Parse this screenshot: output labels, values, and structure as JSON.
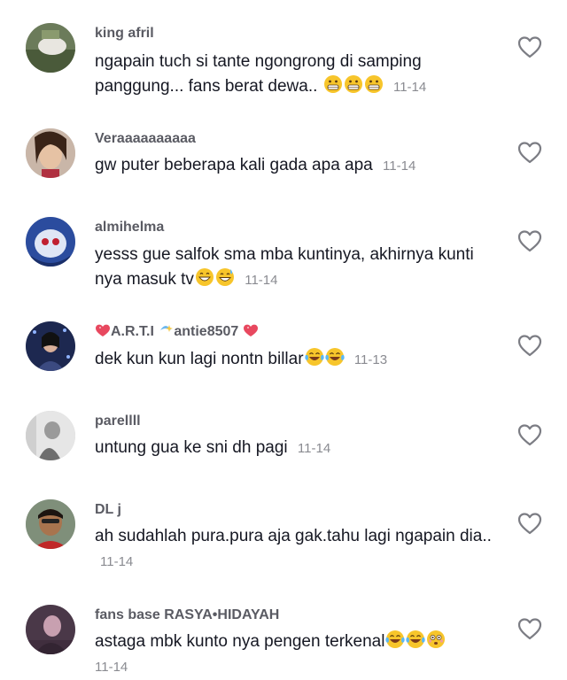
{
  "comments": [
    {
      "username": "king afril",
      "text": "ngapain tuch si tante ngongrong di samping panggung... fans berat dewa..",
      "date": "11-14"
    },
    {
      "username": "Veraaaaaaaaaa",
      "text": "gw puter beberapa kali gada apa apa",
      "date": "11-14"
    },
    {
      "username": "almihelma",
      "text": "yesss gue salfok sma mba kuntinya, akhirnya kunti nya masuk tv",
      "date": "11-14"
    },
    {
      "username_part1": "A.R.T.I",
      "username_part2": "antie8507",
      "text": "dek kun kun lagi nontn billar",
      "date": "11-13"
    },
    {
      "username": "parellll",
      "text": "untung gua ke sni dh pagi",
      "date": "11-14"
    },
    {
      "username": "DL j",
      "text": "ah sudahlah pura.pura aja gak.tahu lagi ngapain dia..",
      "date": "11-14"
    },
    {
      "username": "fans base RASYA•HIDAYAH",
      "text": "astaga mbk kunto nya pengen terkenal",
      "date": "11-14"
    }
  ],
  "icons": {
    "like": "heart-outline-icon",
    "emoji_grimace": "grimacing-face-emoji",
    "emoji_grin": "grinning-face-emoji",
    "emoji_sweat": "grinning-sweat-emoji",
    "emoji_laugh": "tears-of-joy-emoji",
    "emoji_flushed": "flushed-face-emoji",
    "user_heart": "heart-sparkle-icon",
    "user_sparkle": "sparkle-icon"
  }
}
